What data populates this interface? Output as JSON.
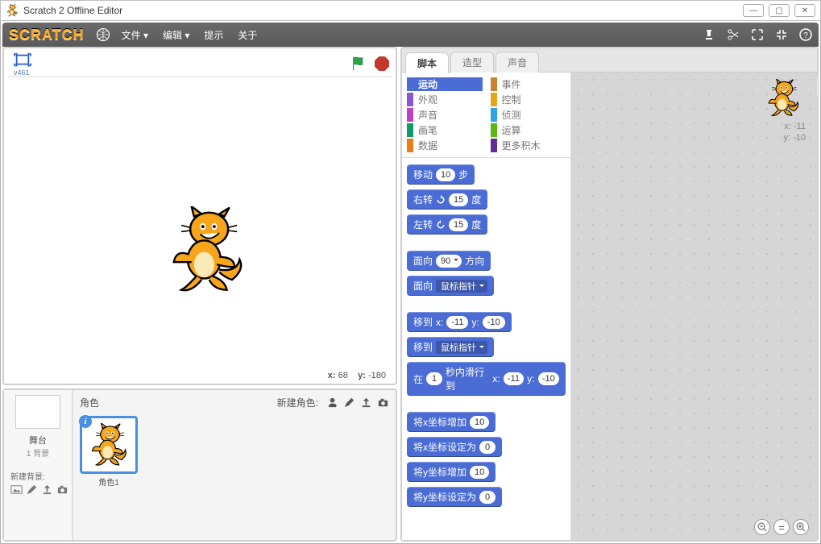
{
  "window": {
    "title": "Scratch 2 Offline Editor"
  },
  "menubar": {
    "logo": "SCRATCH",
    "items": [
      "文件 ▾",
      "编辑 ▾",
      "提示",
      "关于"
    ]
  },
  "stage": {
    "view_label": "v461",
    "coord_x_label": "x:",
    "coord_x": "68",
    "coord_y_label": "y:",
    "coord_y": "-180"
  },
  "backdrop": {
    "stage_label": "舞台",
    "count_label": "1 背景",
    "new_label": "新建背景:"
  },
  "sprites": {
    "panel_title": "角色",
    "new_label": "新建角色:",
    "items": [
      {
        "name": "角色1"
      }
    ]
  },
  "tabs": [
    "脚本",
    "造型",
    "声音"
  ],
  "categories": [
    {
      "name": "运动",
      "color": "#4a6cd4",
      "selected": true
    },
    {
      "name": "事件",
      "color": "#c88330"
    },
    {
      "name": "外观",
      "color": "#8a55d7"
    },
    {
      "name": "控制",
      "color": "#e1a91a"
    },
    {
      "name": "声音",
      "color": "#bb42c3"
    },
    {
      "name": "侦测",
      "color": "#2ca5e2"
    },
    {
      "name": "画笔",
      "color": "#0e9a6c"
    },
    {
      "name": "运算",
      "color": "#5cb712"
    },
    {
      "name": "数据",
      "color": "#ee7d16"
    },
    {
      "name": "更多积木",
      "color": "#632d99"
    }
  ],
  "blocks": {
    "move": {
      "pre": "移动",
      "val": "10",
      "post": "步"
    },
    "turn_cw": {
      "pre": "右转",
      "val": "15",
      "post": "度"
    },
    "turn_ccw": {
      "pre": "左转",
      "val": "15",
      "post": "度"
    },
    "point_dir": {
      "pre": "面向",
      "val": "90",
      "post": "方向"
    },
    "point_to": {
      "pre": "面向",
      "dd": "鼠标指针"
    },
    "goto_xy": {
      "pre": "移到",
      "xl": "x:",
      "x": "-11",
      "yl": "y:",
      "y": "-10"
    },
    "goto": {
      "pre": "移到",
      "dd": "鼠标指针"
    },
    "glide": {
      "pre": "在",
      "sec": "1",
      "mid": "秒内滑行到",
      "xl": "x:",
      "x": "-11",
      "yl": "y:",
      "y": "-10"
    },
    "change_x": {
      "pre": "将x坐标增加",
      "val": "10"
    },
    "set_x": {
      "pre": "将x坐标设定为",
      "val": "0"
    },
    "change_y": {
      "pre": "将y坐标增加",
      "val": "10"
    },
    "set_y": {
      "pre": "将y坐标设定为",
      "val": "0"
    }
  },
  "scripts_area": {
    "x_label": "x:",
    "x": "-11",
    "y_label": "y:",
    "y": "-10"
  }
}
